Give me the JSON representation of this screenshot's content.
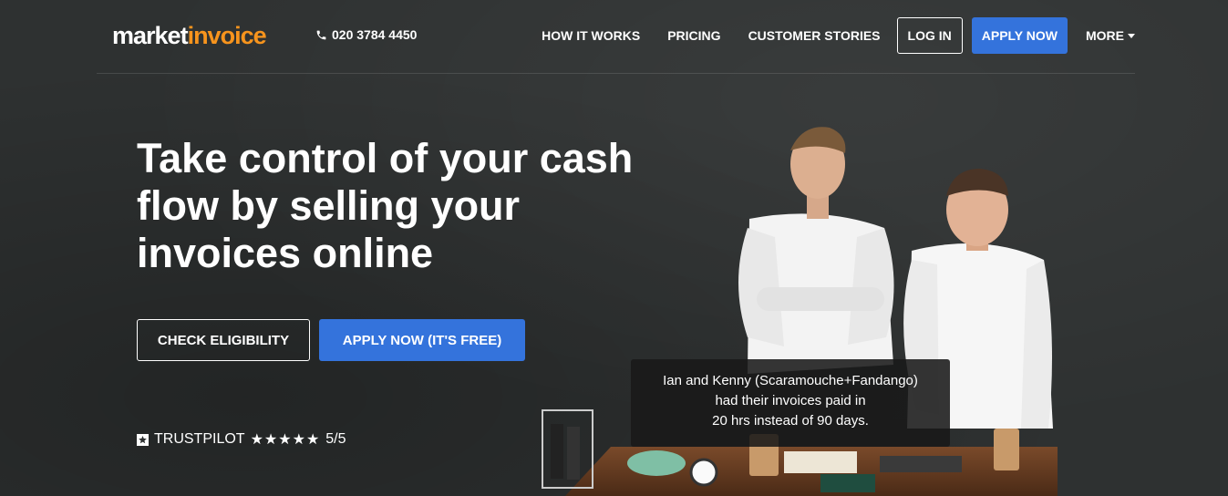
{
  "header": {
    "logo_part1": "market",
    "logo_part2": "invoice",
    "phone": "020 3784 4450",
    "nav": [
      "HOW IT WORKS",
      "PRICING",
      "CUSTOMER STORIES"
    ],
    "login_label": "LOG IN",
    "apply_label": "APPLY NOW",
    "more_label": "MORE"
  },
  "hero": {
    "headline": "Take control of your cash flow by selling your invoices online",
    "check_label": "CHECK ELIGIBILITY",
    "apply_label": "APPLY NOW (IT'S FREE)",
    "trustpilot": "TRUSTPILOT",
    "stars": "★★★★★",
    "rating": "5/5"
  },
  "caption": {
    "line1": "Ian and Kenny (Scaramouche+Fandango)",
    "line2": "had their invoices paid in",
    "line3": "20 hrs instead of 90 days."
  },
  "colors": {
    "accent": "#3473dc",
    "logo_orange": "#f7941d",
    "background": "#2e3131"
  },
  "icons": {
    "phone": "phone-icon",
    "more": "caret-down-icon",
    "trustpilot": "trustpilot-star-icon"
  }
}
